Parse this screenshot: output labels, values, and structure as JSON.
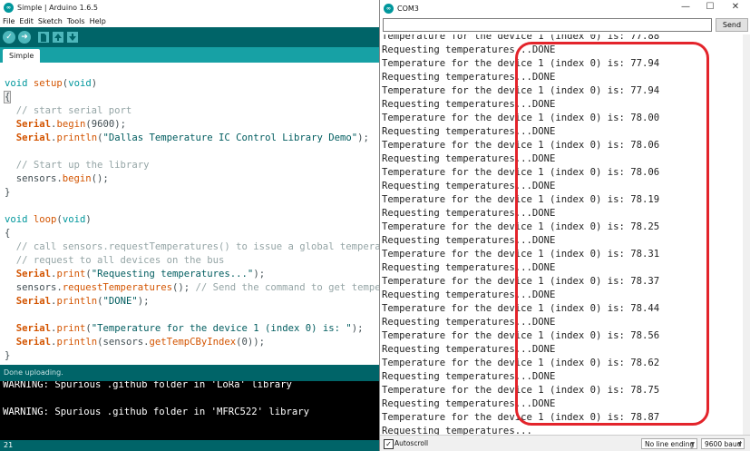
{
  "ide": {
    "title": "Simple | Arduino 1.6.5",
    "logo": "∞",
    "menu": [
      "File",
      "Edit",
      "Sketch",
      "Tools",
      "Help"
    ],
    "toolbar_icons": [
      "verify-icon",
      "upload-icon",
      "new-icon",
      "open-icon",
      "save-icon"
    ],
    "tab": "Simple",
    "status": "Done uploading.",
    "line_number": "21",
    "console_lines": [
      "WARNING: Spurious .github folder in 'LoRa' library",
      "",
      "WARNING: Spurious .github folder in 'MFRC522' library"
    ],
    "colors": {
      "teal_dark": "#006468",
      "teal_tab": "#17a1a5",
      "keyword": "#00979c",
      "function": "#d35400"
    }
  },
  "serial": {
    "title": "COM3",
    "input_value": "",
    "send_label": "Send",
    "autoscroll_label": "Autoscroll",
    "autoscroll_checked": true,
    "line_ending": "No line ending",
    "baud": "9600 baud",
    "partial_top_line": "Temperature for the device 1 (index 0) is: 77.88",
    "request_line": "Requesting temperatures...DONE",
    "temp_prefix": "Temperature for the device 1 (index 0) is: ",
    "temperatures": [
      "77.94",
      "77.94",
      "78.00",
      "78.06",
      "78.06",
      "78.19",
      "78.25",
      "78.31",
      "78.37",
      "78.44",
      "78.56",
      "78.62",
      "78.75",
      "78.87"
    ],
    "last_line": "Requesting temperatures...",
    "highlight_color": "#e3242b"
  }
}
